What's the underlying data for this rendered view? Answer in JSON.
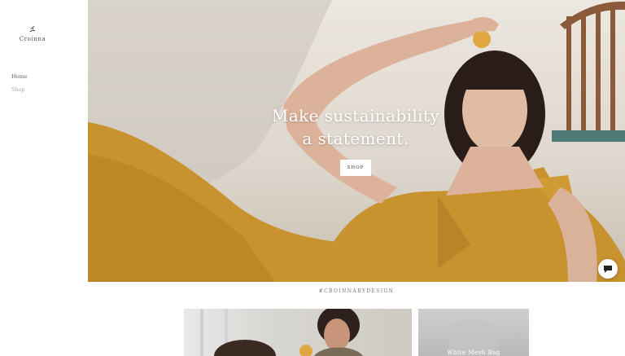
{
  "brand": {
    "name": "Croinna",
    "logo_icon": "leaf-hand-icon"
  },
  "nav": {
    "items": [
      {
        "label": "Home"
      },
      {
        "label": "Shop"
      }
    ]
  },
  "hero": {
    "headline_line1": "Make sustainability",
    "headline_line2": "a statement.",
    "cta_label": "SHOP"
  },
  "chat": {
    "icon": "chat-bubble-icon"
  },
  "feed": {
    "hashtag": "#CROINNABYDESIGN",
    "items": [
      {
        "caption": ""
      },
      {
        "caption": "White Mesh Bag"
      }
    ]
  },
  "colors": {
    "accent": "#c8922e",
    "hero_bg": "#e6e0d7",
    "sidebar_bg": "#ffffff"
  }
}
